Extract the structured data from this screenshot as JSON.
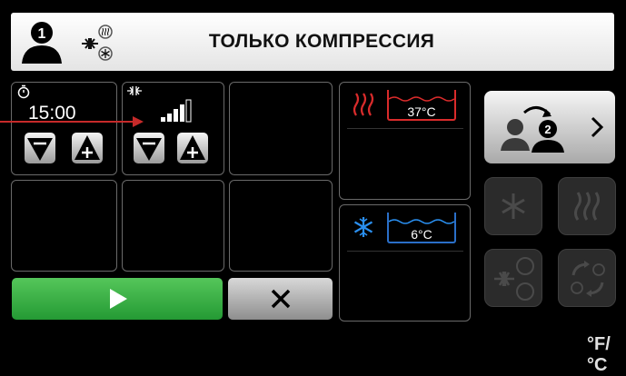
{
  "header": {
    "title": "ТОЛЬКО КОМПРЕССИЯ",
    "user_badge": "1",
    "icons": [
      "user-icon",
      "compression-heat-cold-icon"
    ]
  },
  "settings": {
    "timer": {
      "value": "15:00",
      "icon": "timer-icon"
    },
    "pressure": {
      "level_bars": 4,
      "level_max": 5,
      "icon": "compression-icon"
    }
  },
  "temperature": {
    "heat": {
      "value": "37°C",
      "icon": "heat-waves-icon",
      "color": "#d92b2b"
    },
    "cold": {
      "value": "6°C",
      "icon": "snowflake-icon",
      "color": "#2a8ff0"
    }
  },
  "actions": {
    "start_icon": "play-icon",
    "stop_icon": "close-icon"
  },
  "side": {
    "switch_user_badge": "2",
    "switch_user_icon": "switch-user-icon",
    "units_label": "°F/°C"
  },
  "colors": {
    "accent_green": "#3cb648",
    "heat_red": "#d92b2b",
    "cold_blue": "#2a8ff0",
    "pointer_red": "#c62a2a"
  }
}
